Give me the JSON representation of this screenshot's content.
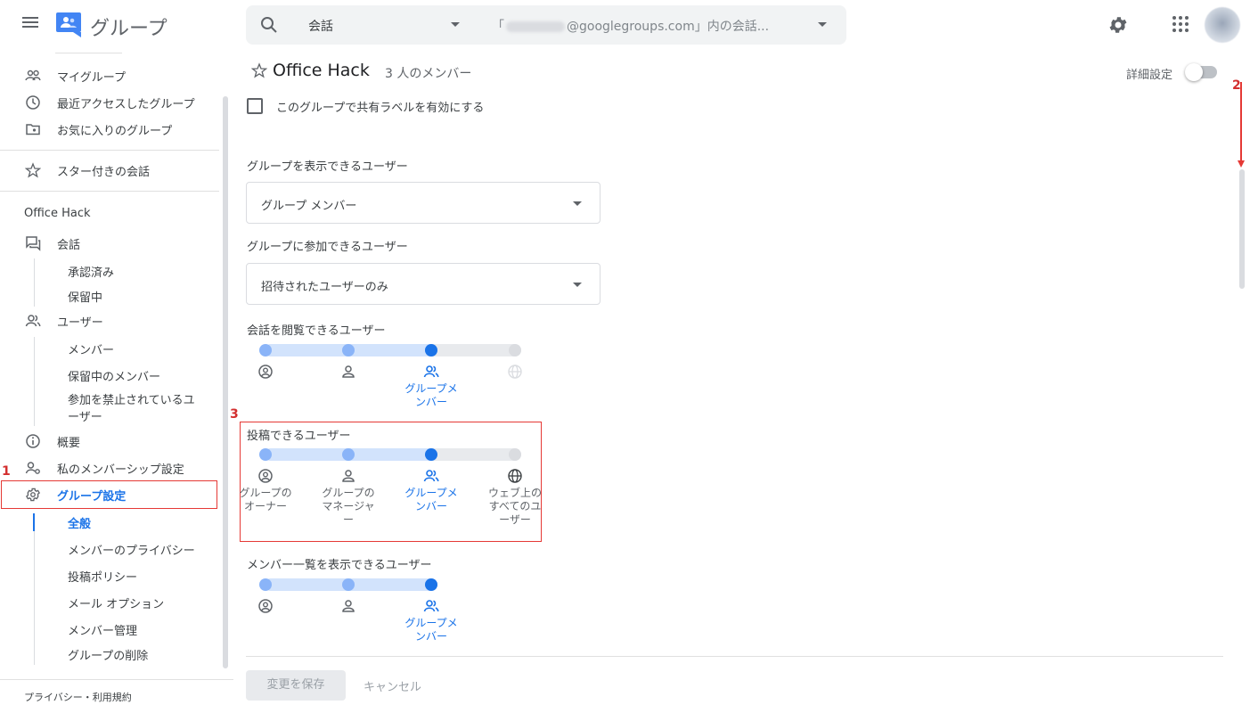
{
  "header": {
    "app_title": "グループ",
    "search_scope": "会話",
    "search_placeholder_prefix": "「",
    "search_placeholder_suffix": "@googlegroups.com」内の会話..."
  },
  "sidebar": {
    "my_groups": "マイグループ",
    "recent": "最近アクセスしたグループ",
    "favorites": "お気に入りのグループ",
    "starred": "スター付きの会話",
    "group_heading": "Office Hack",
    "conversations": "会話",
    "approved": "承認済み",
    "pending": "保留中",
    "users": "ユーザー",
    "members": "メンバー",
    "pending_members": "保留中のメンバー",
    "banned_line1": "参加を禁止されているユ",
    "banned_line2": "ーザー",
    "about": "概要",
    "membership_settings": "私のメンバーシップ設定",
    "group_settings": "グループ設定",
    "general": "全般",
    "member_privacy": "メンバーのプライバシー",
    "posting_policy": "投稿ポリシー",
    "email_options": "メール オプション",
    "member_management": "メンバー管理",
    "delete_group": "グループの削除",
    "privacy_terms": "プライバシー・利用規約"
  },
  "main": {
    "group_name": "Office Hack",
    "member_count": "3 人のメンバー",
    "advanced_label": "詳細設定",
    "shared_label_text": "このグループで共有ラベルを有効にする",
    "who_can_see_label": "グループを表示できるユーザー",
    "who_can_see_value": "グループ メンバー",
    "who_can_join_label": "グループに参加できるユーザー",
    "who_can_join_value": "招待されたユーザーのみ",
    "view_conversations_label": "会話を閲覧できるユーザー",
    "view_conversations_selected": "グループメンバー",
    "post_label": "投稿できるユーザー",
    "post_options": [
      "グループのオーナー",
      "グループのマネージャー",
      "グループメンバー",
      "ウェブ上のすべてのユーザー"
    ],
    "post_selected_index": 2,
    "view_members_label": "メンバー一覧を表示できるユーザー",
    "view_members_selected": "グループメンバー",
    "save_button": "変更を保存",
    "cancel_button": "キャンセル"
  },
  "annotations": {
    "n1": "1",
    "n2": "2",
    "n3": "3"
  },
  "colors": {
    "accent": "#1a73e8",
    "annotation": "#e53935"
  }
}
